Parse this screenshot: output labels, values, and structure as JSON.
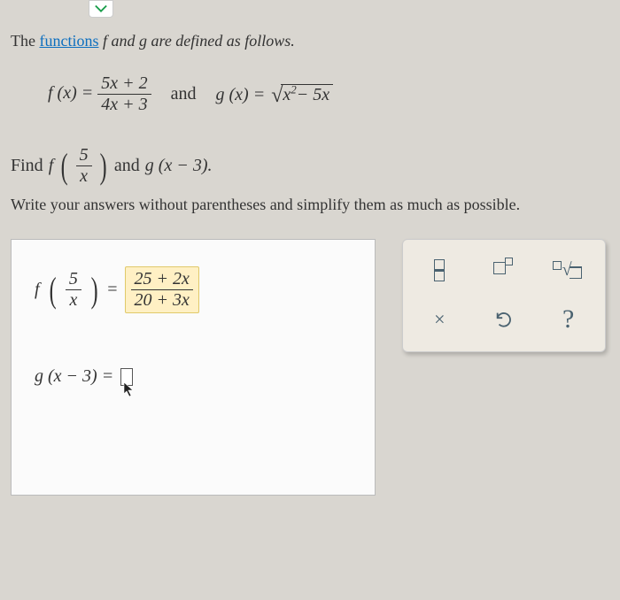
{
  "intro_pre": "The ",
  "intro_link": "functions",
  "intro_post": " f and g are defined as follows.",
  "formula_f_lhs": "f (x) =",
  "formula_f_num": "5x + 2",
  "formula_f_den": "4x + 3",
  "and_word": "and",
  "formula_g_lhs": "g (x) =",
  "formula_g_radicand": "x",
  "formula_g_exp": "2",
  "formula_g_tail": "− 5x",
  "task_find": "Find",
  "task_f": "f",
  "task_f_arg_num": "5",
  "task_f_arg_den": "x",
  "task_and": "and",
  "task_g": "g (x − 3).",
  "instruction": "Write your answers without parentheses and simplify them as much as possible.",
  "answer_f_pre": "f",
  "answer_f_arg_num": "5",
  "answer_f_arg_den": "x",
  "answer_eq": "=",
  "answer_f_num": "25 + 2x",
  "answer_f_den": "20 + 3x",
  "answer_g_lhs": "g (x − 3) =",
  "toolbox": {
    "close": "×",
    "help": "?"
  }
}
